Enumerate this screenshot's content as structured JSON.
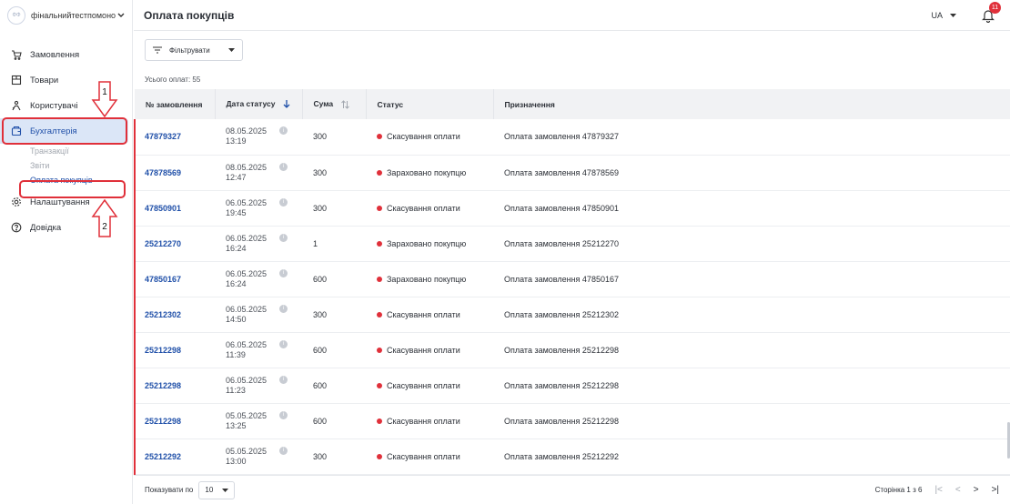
{
  "sidebar": {
    "account_logo": "ФФ",
    "account_name": "фінальнийтестпомоно",
    "items": [
      {
        "label": "Замовлення",
        "icon": "cart-icon"
      },
      {
        "label": "Товари",
        "icon": "box-icon"
      },
      {
        "label": "Користувачі",
        "icon": "users-icon"
      },
      {
        "label": "Бухгалтерія",
        "icon": "wallet-icon"
      },
      {
        "label": "Налаштування",
        "icon": "gear-icon"
      },
      {
        "label": "Довідка",
        "icon": "help-icon"
      }
    ],
    "sub_items": [
      "Транзакції",
      "Звіти",
      "Оплата покупців"
    ],
    "callout_1": "1",
    "callout_2": "2"
  },
  "header": {
    "title": "Оплата покупців",
    "lang": "UA",
    "notifications": "11"
  },
  "filter": {
    "label": "Фільтрувати"
  },
  "total_label": "Усього оплат: 55",
  "table": {
    "columns": [
      "№ замовлення",
      "Дата статусу",
      "Сума",
      "Статус",
      "Призначення"
    ],
    "rows": [
      {
        "order": "47879327",
        "date": "08.05.2025",
        "time": "13:19",
        "sum": "300",
        "status": "Скасування оплати",
        "purpose": "Оплата замовлення 47879327"
      },
      {
        "order": "47878569",
        "date": "08.05.2025",
        "time": "12:47",
        "sum": "300",
        "status": "Зараховано покупцю",
        "purpose": "Оплата замовлення 47878569"
      },
      {
        "order": "47850901",
        "date": "06.05.2025",
        "time": "19:45",
        "sum": "300",
        "status": "Скасування оплати",
        "purpose": "Оплата замовлення 47850901"
      },
      {
        "order": "25212270",
        "date": "06.05.2025",
        "time": "16:24",
        "sum": "1",
        "status": "Зараховано покупцю",
        "purpose": "Оплата замовлення 25212270"
      },
      {
        "order": "47850167",
        "date": "06.05.2025",
        "time": "16:24",
        "sum": "600",
        "status": "Зараховано покупцю",
        "purpose": "Оплата замовлення 47850167"
      },
      {
        "order": "25212302",
        "date": "06.05.2025",
        "time": "14:50",
        "sum": "300",
        "status": "Скасування оплати",
        "purpose": "Оплата замовлення 25212302"
      },
      {
        "order": "25212298",
        "date": "06.05.2025",
        "time": "11:39",
        "sum": "600",
        "status": "Скасування оплати",
        "purpose": "Оплата замовлення 25212298"
      },
      {
        "order": "25212298",
        "date": "06.05.2025",
        "time": "11:23",
        "sum": "600",
        "status": "Скасування оплати",
        "purpose": "Оплата замовлення 25212298"
      },
      {
        "order": "25212298",
        "date": "05.05.2025",
        "time": "13:25",
        "sum": "600",
        "status": "Скасування оплати",
        "purpose": "Оплата замовлення 25212298"
      },
      {
        "order": "25212292",
        "date": "05.05.2025",
        "time": "13:00",
        "sum": "300",
        "status": "Скасування оплати",
        "purpose": "Оплата замовлення 25212292"
      }
    ]
  },
  "footer": {
    "per_page_label": "Показувати по",
    "per_page_value": "10",
    "page_label": "Сторінка 1 з 6"
  },
  "colors": {
    "accent": "#1f4fa8",
    "status_red": "#e0303a",
    "active_bg": "#dbe6f7"
  }
}
